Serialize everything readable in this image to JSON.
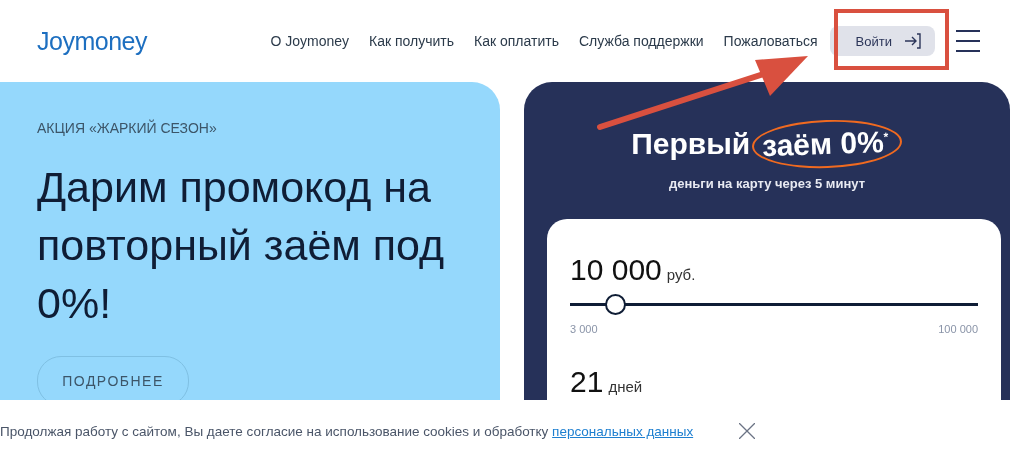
{
  "header": {
    "logo": "Joymoney",
    "nav": [
      "О Joymoney",
      "Как получить",
      "Как оплатить",
      "Служба поддержки",
      "Пожаловаться"
    ],
    "login": "Войти"
  },
  "promo": {
    "tag": "АКЦИЯ «ЖАРКИЙ СЕЗОН»",
    "headline": "Дарим промокод на повторный заём под 0%!",
    "button": "ПОДРОБНЕЕ"
  },
  "loan": {
    "title": "Первый",
    "title_highlight": {
      "text": "заём 0%$^{*}$",
      "circled": true
    },
    "subtitle": "деньги на карту через 5 минут",
    "amount": "10 000",
    "currency": "руб.",
    "slider": {
      "level": 0.09
    },
    "min": "3 000",
    "max": "100 000",
    "term": "21",
    "term_unit": "дней"
  },
  "cookie": {
    "text": "Продолжая работу с сайтом, Вы даете согласие на использование cookies и обработку",
    "link": "персональных данных"
  },
  "annotations": {
    "login_frame": true,
    "pointer_arrow": true
  }
}
